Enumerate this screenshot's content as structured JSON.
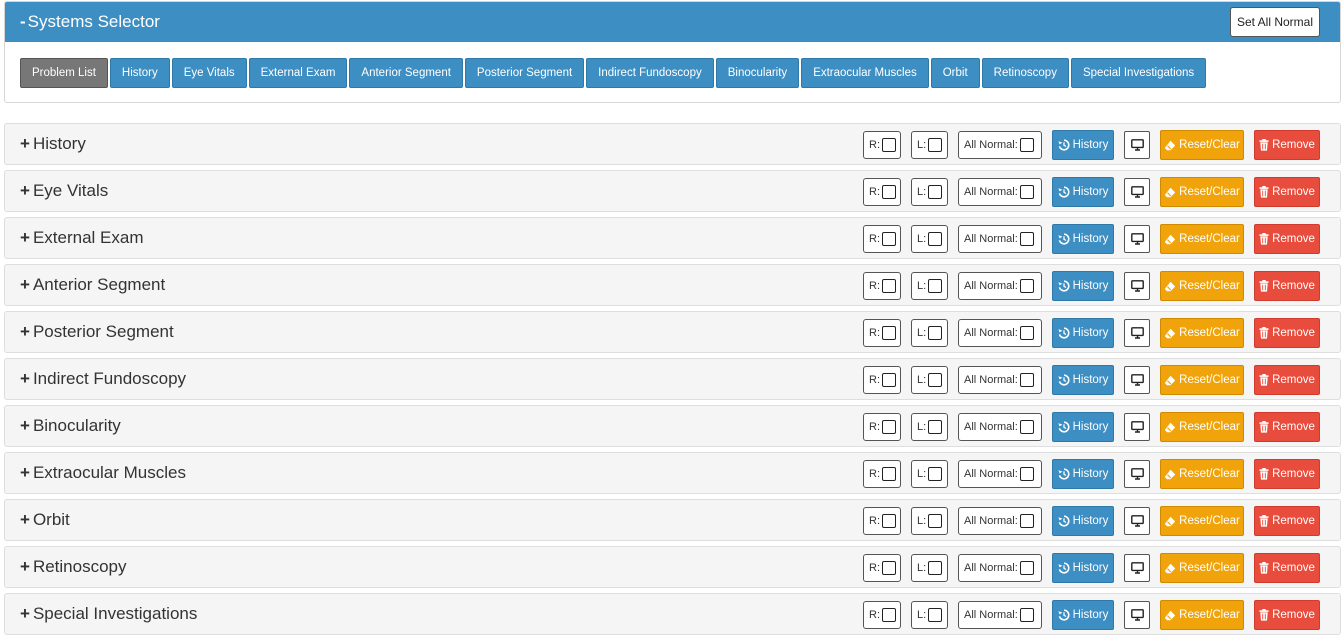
{
  "selector": {
    "title_sign": "-",
    "title": "Systems Selector",
    "set_all_normal_label": "Set All Normal",
    "tabs": [
      {
        "label": "Problem List",
        "active": true
      },
      {
        "label": "History"
      },
      {
        "label": "Eye Vitals"
      },
      {
        "label": "External Exam"
      },
      {
        "label": "Anterior Segment"
      },
      {
        "label": "Posterior Segment"
      },
      {
        "label": "Indirect Fundoscopy"
      },
      {
        "label": "Binocularity"
      },
      {
        "label": "Extraocular Muscles"
      },
      {
        "label": "Orbit"
      },
      {
        "label": "Retinoscopy"
      },
      {
        "label": "Special Investigations"
      }
    ]
  },
  "section_controls": {
    "expand_sign": "+",
    "right_label": "R:",
    "left_label": "L:",
    "all_normal_label": "All Normal:",
    "history_label": "History",
    "reset_label": "Reset/Clear",
    "remove_label": "Remove"
  },
  "sections": [
    {
      "title": "History"
    },
    {
      "title": "Eye Vitals"
    },
    {
      "title": "External Exam"
    },
    {
      "title": "Anterior Segment"
    },
    {
      "title": "Posterior Segment"
    },
    {
      "title": "Indirect Fundoscopy"
    },
    {
      "title": "Binocularity"
    },
    {
      "title": "Extraocular Muscles"
    },
    {
      "title": "Orbit"
    },
    {
      "title": "Retinoscopy"
    },
    {
      "title": "Special Investigations"
    }
  ],
  "icons": {
    "history": "history-icon",
    "display": "monitor-icon",
    "reset": "eraser-icon",
    "remove": "trash-icon"
  },
  "colors": {
    "primary": "#3d8ec2",
    "active_tab": "#777777",
    "warning": "#f0a30a",
    "danger": "#e74c3c"
  }
}
